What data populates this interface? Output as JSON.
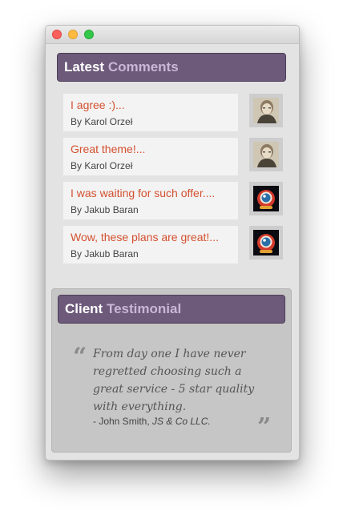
{
  "latest": {
    "header_word1": "Latest",
    "header_word2": "Comments",
    "comments": [
      {
        "title": "I agree :)...",
        "author": "By Karol Orzeł",
        "avatar": "man-portrait-avatar"
      },
      {
        "title": "Great theme!...",
        "author": "By Karol Orzeł",
        "avatar": "man-portrait-avatar"
      },
      {
        "title": "I was waiting for such offer....",
        "author": "By Jakub Baran",
        "avatar": "astronaut-avatar"
      },
      {
        "title": "Wow, these plans are great!...",
        "author": "By Jakub Baran",
        "avatar": "astronaut-avatar"
      }
    ]
  },
  "testimonial": {
    "header_word1": "Client",
    "header_word2": "Testimonial",
    "quote": "From day one I have never regretted choosing such a great service - 5 star quality with everything.",
    "signature_prefix": "- John Smith, ",
    "signature_company": "JS & Co LLC."
  },
  "colors": {
    "header_bg": "#6d5a7a",
    "header_accent": "#c9b7d6",
    "comment_title": "#d4502f"
  }
}
